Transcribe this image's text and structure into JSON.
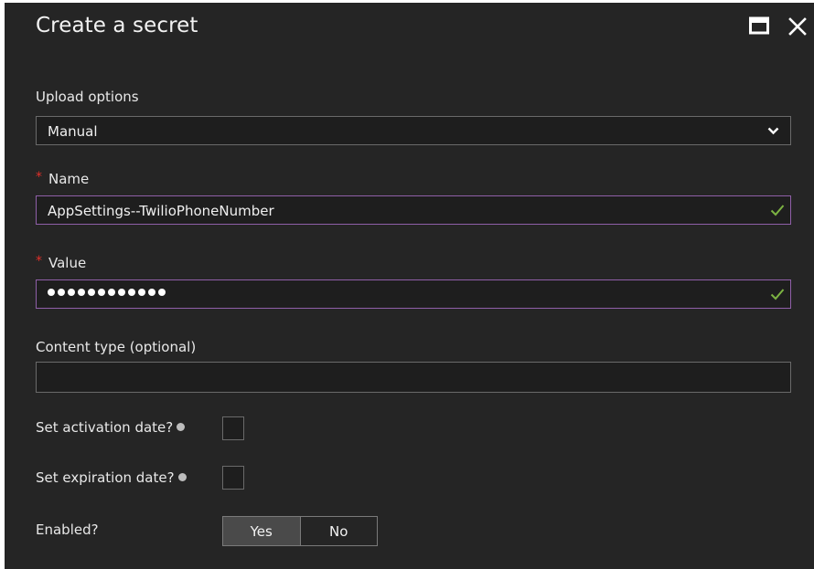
{
  "dialog": {
    "title": "Create a secret"
  },
  "upload_options": {
    "label": "Upload options",
    "selected": "Manual"
  },
  "name": {
    "label": "Name",
    "value": "AppSettings--TwilioPhoneNumber",
    "required": true,
    "valid": true
  },
  "value": {
    "label": "Value",
    "masked_char_count": 12,
    "required": true,
    "valid": true
  },
  "content_type": {
    "label": "Content type (optional)",
    "value": ""
  },
  "activation": {
    "label": "Set activation date?",
    "checked": false
  },
  "expiration": {
    "label": "Set expiration date?",
    "checked": false
  },
  "enabled": {
    "label": "Enabled?",
    "options": [
      "Yes",
      "No"
    ],
    "selected": "Yes"
  },
  "colors": {
    "panel_bg": "#252525",
    "focus_border": "#8f5fa8",
    "required_star": "#e0302a",
    "valid_check": "#7cb342"
  },
  "icons": [
    "maximize-icon",
    "close-icon",
    "chevron-down-icon",
    "checkmark-icon",
    "info-icon"
  ]
}
